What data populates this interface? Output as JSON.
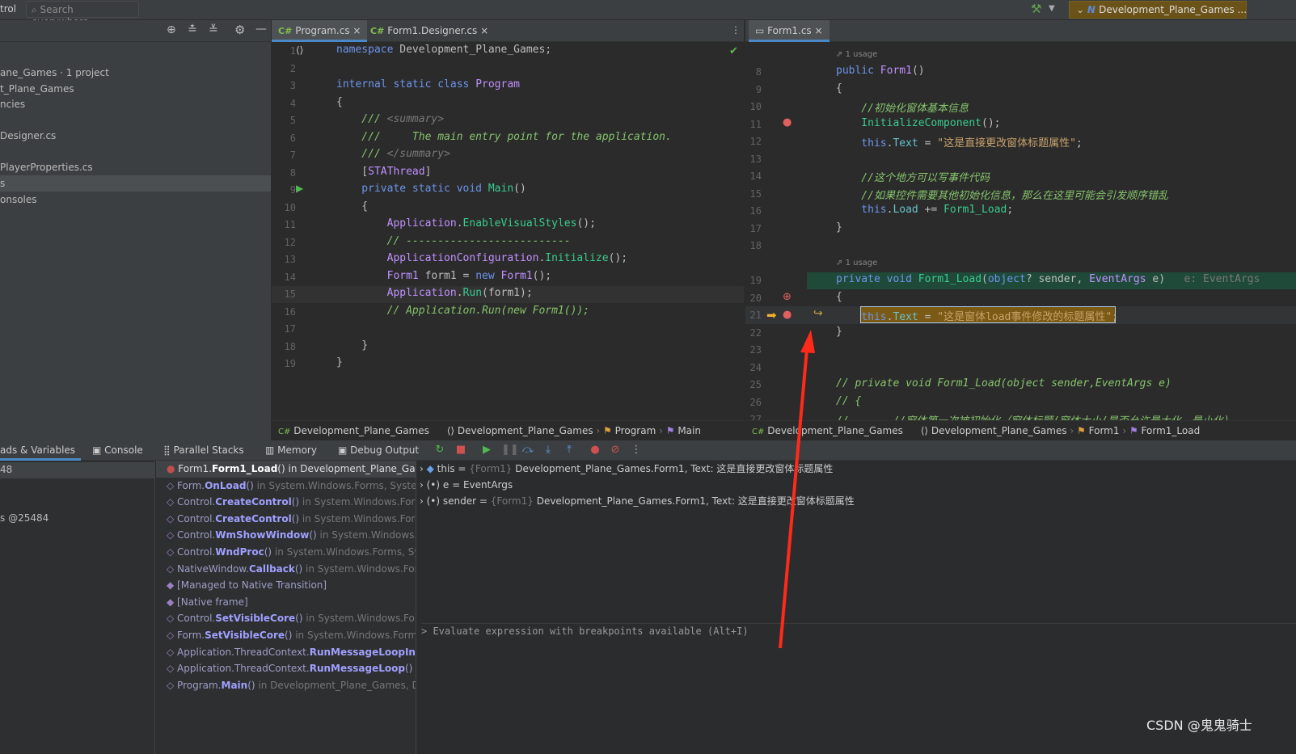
{
  "topbar": {
    "left_text": "trol",
    "search_placeholder": "Search everywhere",
    "run_config": "Development_Plane_Games ..."
  },
  "project": {
    "items": [
      "ane_Games · 1 project",
      "t_Plane_Games",
      "ncies",
      "Designer.cs",
      "PlayerProperties.cs",
      "s",
      "onsoles"
    ]
  },
  "editor_left": {
    "tabs": [
      {
        "label": "Program.cs",
        "active": true
      },
      {
        "label": "Form1.Designer.cs",
        "active": false
      }
    ],
    "lines": [
      {
        "n": "1",
        "t": [
          [
            "namespace ",
            "kw"
          ],
          [
            "Development_Plane_Games",
            ""
          ],
          [
            ";",
            ""
          ]
        ]
      },
      {
        "n": "2",
        "t": []
      },
      {
        "n": "3",
        "t": [
          [
            "internal static class ",
            "kw"
          ],
          [
            "Program",
            "ty"
          ]
        ]
      },
      {
        "n": "4",
        "t": [
          [
            "{",
            ""
          ]
        ]
      },
      {
        "n": "5",
        "t": [
          [
            "    /// ",
            "dc"
          ],
          [
            "<summary>",
            "dt"
          ]
        ]
      },
      {
        "n": "6",
        "t": [
          [
            "    ///     The main entry point for the application.",
            "dc"
          ]
        ]
      },
      {
        "n": "7",
        "t": [
          [
            "    /// ",
            "dc"
          ],
          [
            "</summary>",
            "dt"
          ]
        ]
      },
      {
        "n": "8",
        "t": [
          [
            "    [",
            ""
          ],
          [
            "STAThread",
            "ty"
          ],
          [
            "]",
            ""
          ]
        ]
      },
      {
        "n": "9",
        "t": [
          [
            "    private static void ",
            "kw"
          ],
          [
            "Main",
            "fn"
          ],
          [
            "()",
            ""
          ]
        ]
      },
      {
        "n": "10",
        "t": [
          [
            "    {",
            ""
          ]
        ]
      },
      {
        "n": "11",
        "t": [
          [
            "        Application",
            "ty"
          ],
          [
            ".",
            ""
          ],
          [
            "EnableVisualStyles",
            "fn"
          ],
          [
            "();",
            ""
          ]
        ]
      },
      {
        "n": "12",
        "t": [
          [
            "        // --------------------------",
            "cm"
          ]
        ]
      },
      {
        "n": "13",
        "t": [
          [
            "        ApplicationConfiguration",
            "ty"
          ],
          [
            ".",
            ""
          ],
          [
            "Initialize",
            "fn"
          ],
          [
            "();",
            ""
          ]
        ]
      },
      {
        "n": "14",
        "t": [
          [
            "        Form1",
            "ty"
          ],
          [
            " form1 = ",
            ""
          ],
          [
            "new ",
            "kw"
          ],
          [
            "Form1",
            "ty"
          ],
          [
            "();",
            ""
          ]
        ]
      },
      {
        "n": "15",
        "t": [
          [
            "        Application",
            "ty"
          ],
          [
            ".",
            ""
          ],
          [
            "Run",
            "fn"
          ],
          [
            "(form1);",
            ""
          ]
        ]
      },
      {
        "n": "16",
        "t": [
          [
            "        // Application.Run(new Form1());",
            "cm"
          ]
        ]
      },
      {
        "n": "17",
        "t": []
      },
      {
        "n": "18",
        "t": [
          [
            "    }",
            ""
          ]
        ]
      },
      {
        "n": "19",
        "t": [
          [
            "}",
            ""
          ]
        ]
      }
    ],
    "breadcrumb": [
      "Development_Plane_Games",
      "Development_Plane_Games",
      "Program",
      "Main"
    ]
  },
  "editor_right": {
    "tabs": [
      {
        "label": "Form1.cs",
        "active": true
      }
    ],
    "usage_label": "1 usage",
    "lines": [
      {
        "n": "8",
        "t": [
          [
            "public ",
            "kw"
          ],
          [
            "Form1",
            "ty"
          ],
          [
            "()",
            ""
          ]
        ]
      },
      {
        "n": "9",
        "t": [
          [
            "{",
            ""
          ]
        ]
      },
      {
        "n": "10",
        "t": [
          [
            "    //初始化窗体基本信息",
            "cm"
          ]
        ]
      },
      {
        "n": "11",
        "t": [
          [
            "    InitializeComponent",
            "fn"
          ],
          [
            "();",
            ""
          ]
        ]
      },
      {
        "n": "12",
        "t": [
          [
            "    this",
            "kw"
          ],
          [
            ".",
            ""
          ],
          [
            "Text",
            "pr"
          ],
          [
            " = ",
            ""
          ],
          [
            "\"这是直接更改窗体标题属性\"",
            "st"
          ],
          [
            ";",
            ""
          ]
        ]
      },
      {
        "n": "13",
        "t": []
      },
      {
        "n": "14",
        "t": [
          [
            "    //这个地方可以写事件代码",
            "cm"
          ]
        ]
      },
      {
        "n": "15",
        "t": [
          [
            "    //如果控件需要其他初始化信息，那么在这里可能会引发顺序错乱",
            "cm"
          ]
        ]
      },
      {
        "n": "16",
        "t": [
          [
            "    this",
            "kw"
          ],
          [
            ".",
            ""
          ],
          [
            "Load",
            "pr"
          ],
          [
            " += ",
            ""
          ],
          [
            "Form1_Load",
            "fn"
          ],
          [
            ";",
            ""
          ]
        ]
      },
      {
        "n": "17",
        "t": [
          [
            "}",
            ""
          ]
        ]
      },
      {
        "n": "18",
        "t": []
      },
      {
        "n": "19",
        "t": [
          [
            "private void ",
            "kw"
          ],
          [
            "Form1_Load",
            "fn"
          ],
          [
            "(",
            ""
          ],
          [
            "object",
            "kw"
          ],
          [
            "? sender, ",
            ""
          ],
          [
            "EventArgs",
            "ty"
          ],
          [
            " e)",
            ""
          ],
          [
            "   e: EventArgs",
            "gr"
          ]
        ]
      },
      {
        "n": "20",
        "t": [
          [
            "{",
            ""
          ]
        ]
      },
      {
        "n": "21",
        "t": [
          [
            "    ",
            ""
          ],
          [
            "this",
            "kw"
          ],
          [
            ".",
            ""
          ],
          [
            "Text",
            "pr"
          ],
          [
            " = ",
            ""
          ],
          [
            "\"这是窗体load事件修改的标题属性\"",
            "st"
          ],
          [
            ";",
            ""
          ]
        ]
      },
      {
        "n": "22",
        "t": [
          [
            "}",
            ""
          ]
        ]
      },
      {
        "n": "23",
        "t": []
      },
      {
        "n": "24",
        "t": []
      },
      {
        "n": "25",
        "t": [
          [
            "// private void Form1_Load(object sender,EventArgs e)",
            "cm"
          ]
        ]
      },
      {
        "n": "26",
        "t": [
          [
            "// {",
            "cm"
          ]
        ]
      },
      {
        "n": "27",
        "t": [
          [
            "//       //窗体第一次被初始化（窗体标题/窗体大小/是否允许最大化、最小化）",
            "cm"
          ]
        ]
      }
    ],
    "breadcrumb": [
      "Development_Plane_Games",
      "Development_Plane_Games",
      "Form1",
      "Form1_Load"
    ]
  },
  "debug": {
    "tabs": [
      "ads & Variables",
      "Console",
      "Parallel Stacks",
      "Memory",
      "Debug Output"
    ],
    "threads": [
      "48",
      "s @25484"
    ],
    "frames": [
      {
        "pre": "Form1.",
        "bold": "Form1_Load",
        "post": "()",
        "in": " in Development_Plane_Games",
        "current": true
      },
      {
        "pre": "Form.",
        "bold": "OnLoad",
        "post": "()",
        "in": " in System.Windows.Forms, System.W"
      },
      {
        "pre": "Control.",
        "bold": "CreateControl",
        "post": "()",
        "in": " in System.Windows.Forms,"
      },
      {
        "pre": "Control.",
        "bold": "CreateControl",
        "post": "()",
        "in": " in System.Windows.Forms,"
      },
      {
        "pre": "Control.",
        "bold": "WmShowWindow",
        "post": "()",
        "in": " in System.Windows.For"
      },
      {
        "pre": "Control.",
        "bold": "WndProc",
        "post": "()",
        "in": " in System.Windows.Forms, Syste"
      },
      {
        "pre": "NativeWindow.",
        "bold": "Callback",
        "post": "()",
        "in": " in System.Windows.Forms"
      },
      {
        "pre": "[Managed to Native Transition]",
        "bold": "",
        "post": "",
        "in": ""
      },
      {
        "pre": "[Native frame]",
        "bold": "",
        "post": "",
        "in": ""
      },
      {
        "pre": "Control.",
        "bold": "SetVisibleCore",
        "post": "()",
        "in": " in System.Windows.Forms,"
      },
      {
        "pre": "Form.",
        "bold": "SetVisibleCore",
        "post": "()",
        "in": " in System.Windows.Forms, S"
      },
      {
        "pre": "Application.ThreadContext.",
        "bold": "RunMessageLoopInner",
        "post": "(",
        "in": ""
      },
      {
        "pre": "Application.ThreadContext.",
        "bold": "RunMessageLoop",
        "post": "()",
        "in": " in Sy"
      },
      {
        "pre": "Program.",
        "bold": "Main",
        "post": "()",
        "in": " in Development_Plane_Games, Dev"
      }
    ],
    "variables": [
      {
        "name": "this",
        "type": "{Form1}",
        "value": "Development_Plane_Games.Form1, Text: 这是直接更改窗体标题属性"
      },
      {
        "name": "e",
        "type": "",
        "value": "EventArgs"
      },
      {
        "name": "sender",
        "type": "{Form1}",
        "value": "Development_Plane_Games.Form1, Text: 这是直接更改窗体标题属性"
      }
    ],
    "evaluate_placeholder": "> Evaluate expression with breakpoints available (Alt+I)"
  },
  "watermark": "CSDN @鬼鬼骑士",
  "colors": {
    "accent": "#4a88c7",
    "run_config_bg": "#6b5218",
    "current_line_bg": "#7a5a14",
    "arrow": "#ff2a1a"
  }
}
